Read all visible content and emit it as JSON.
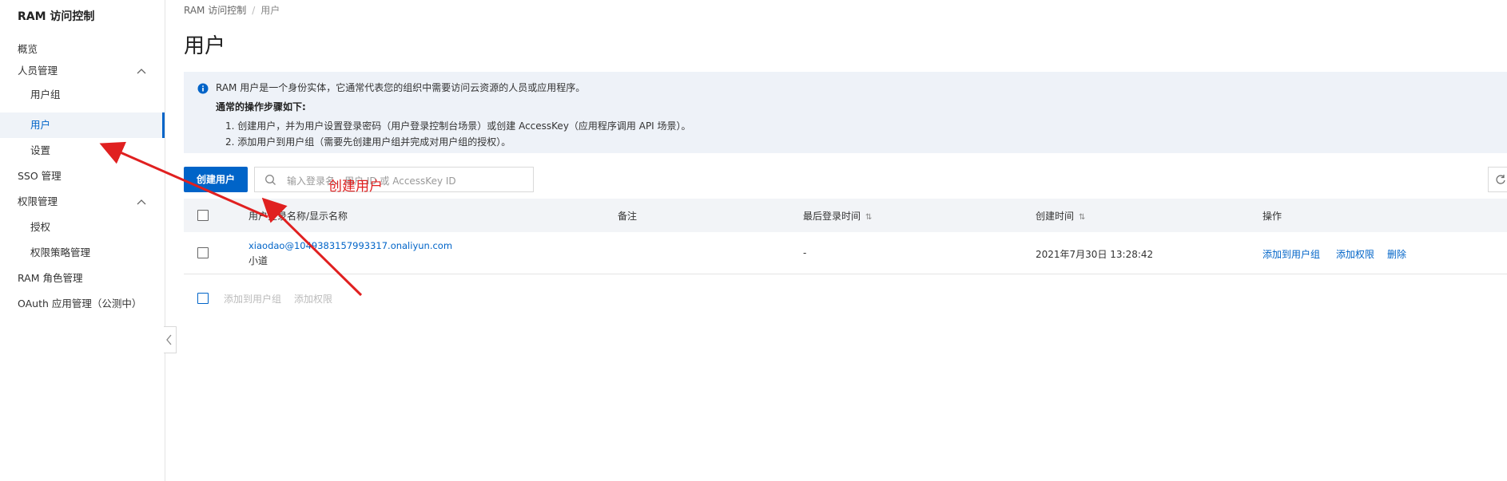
{
  "sidebar": {
    "title": "RAM 访问控制",
    "items": [
      {
        "label": "概览"
      },
      {
        "label": "人员管理"
      },
      {
        "label": "用户组"
      },
      {
        "label": "用户"
      },
      {
        "label": "设置"
      },
      {
        "label": "SSO 管理"
      },
      {
        "label": "权限管理"
      },
      {
        "label": "授权"
      },
      {
        "label": "权限策略管理"
      },
      {
        "label": "RAM 角色管理"
      },
      {
        "label": "OAuth 应用管理（公测中）"
      }
    ]
  },
  "breadcrumb": {
    "root": "RAM 访问控制",
    "sep": "/",
    "current": "用户"
  },
  "page_title": "用户",
  "info": {
    "line1": "RAM 用户是一个身份实体，它通常代表您的组织中需要访问云资源的人员或应用程序。",
    "heading": "通常的操作步骤如下:",
    "step1": "1. 创建用户，并为用户设置登录密码（用户登录控制台场景）或创建 AccessKey（应用程序调用 API 场景）。",
    "step2": "2. 添加用户到用户组（需要先创建用户组并完成对用户组的授权）。"
  },
  "toolbar": {
    "create_label": "创建用户",
    "search_placeholder": "输入登录名、用户 ID 或 AccessKey ID"
  },
  "table": {
    "headers": {
      "name": "用户登录名称/显示名称",
      "note": "备注",
      "last_login": "最后登录时间",
      "created": "创建时间",
      "actions": "操作"
    },
    "sort_glyph": "⇅",
    "rows": [
      {
        "login": "xiaodao@1049383157993317.onaliyun.com",
        "display": "小道",
        "note": "",
        "last_login": "-",
        "created": "2021年7月30日 13:28:42",
        "actions": [
          "添加到用户组",
          "添加权限",
          "删除"
        ]
      }
    ]
  },
  "batch": {
    "add_group": "添加到用户组",
    "add_perm": "添加权限"
  },
  "annotation": {
    "text": "创建用户",
    "color": "#e02020"
  },
  "colors": {
    "primary": "#0064c8",
    "info_bg": "#eef2f8",
    "header_bg": "#f2f4f7"
  }
}
